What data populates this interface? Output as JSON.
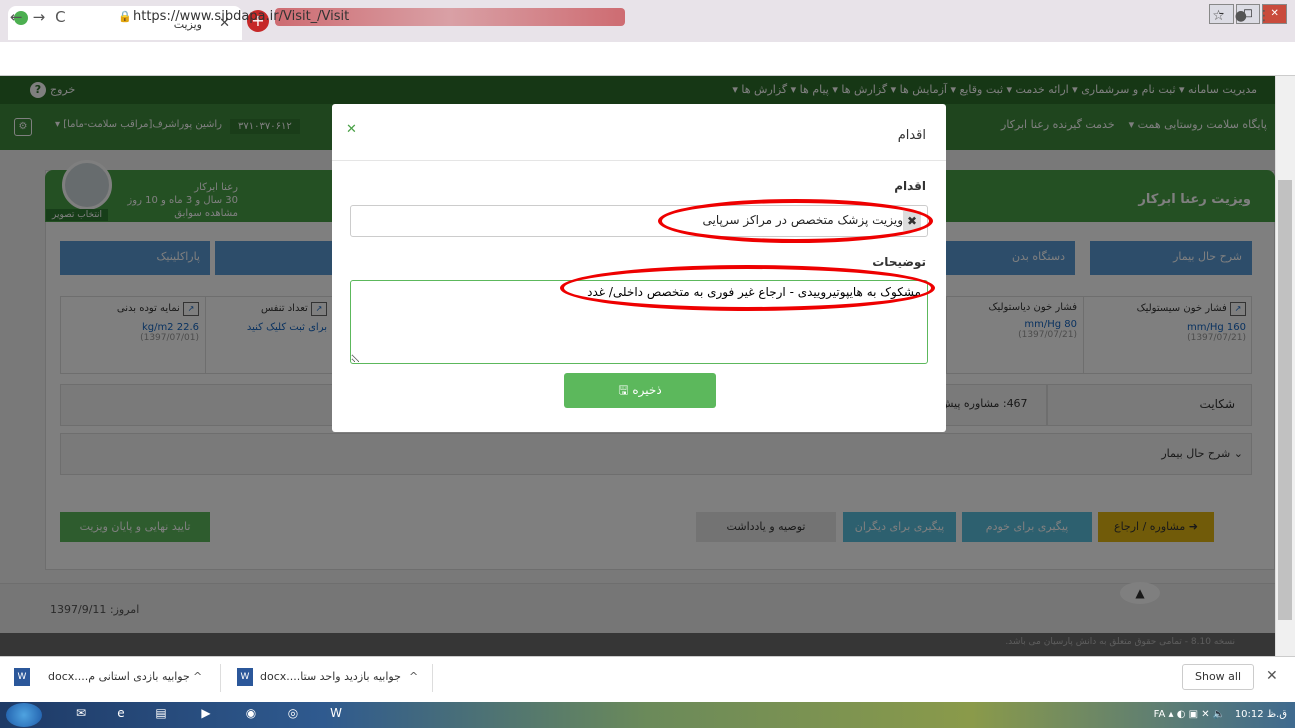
{
  "browser": {
    "tab_title": "ویزیت",
    "url": "https://www.sibdapa.ir/Visit_/Visit"
  },
  "topnav": {
    "menu": "مدیریت سامانه ▾   ثبت نام و سرشماری ▾   ارائه خدمت ▾   ثبت وقایع ▾   آزمایش ها ▾   گزارش ها ▾   پیام ها ▾   گزارش ها ▾",
    "exit": "خروج",
    "help": "?"
  },
  "subnav": {
    "facility": "پایگاه سلامت روستایی همت ▾",
    "recipient": "خدمت گیرنده رعنا ابرکار",
    "phone": "۳۷۱۰۳۷۰۶۱۲",
    "user": "راشین پوراشرف[مراقب سلامت-ماما] ▾"
  },
  "patient": {
    "visit_title": "ویزیت رعنا ابرکار",
    "name": "رعنا ابرکار",
    "age": "30 سال و 3 ماه و 10 روز",
    "history": "مشاهده سوابق",
    "photo_btn": "انتخاب تصویر"
  },
  "tabs": {
    "sharh": "شرح حال بیمار",
    "dastgah": "دستگاه بدن",
    "para": "پاراکلینیک"
  },
  "vitals": [
    {
      "label": "فشار خون سیستولیک",
      "value": "mm/Hg 160",
      "date": "(1397/07/21)"
    },
    {
      "label": "فشار خون دیاستولیک",
      "value": "mm/Hg 80",
      "date": "(1397/07/21)"
    },
    {
      "label": "تعداد تنفس",
      "value": "برای ثبت کلیک کنید",
      "date": ""
    },
    {
      "label": "نمایه توده بدنی",
      "value": "kg/m2 22.6",
      "date": "(1397/07/01)"
    }
  ],
  "complaint": {
    "label": "شکایت",
    "value": "467: مشاوره پیش"
  },
  "history_label": "شرح حال بیمار",
  "actions": {
    "referral": "مشاوره / ارجاع",
    "self": "پیگیری برای خودم",
    "others": "پیگیری برای دیگران",
    "note": "توصیه و یادداشت",
    "final": "تایید نهایی و پایان ویزیت"
  },
  "footer": {
    "today": "امروز: 1397/9/11",
    "version": "نسخه 8.10 - تمامی حقوق متعلق به دانش پارسیان می باشد."
  },
  "modal": {
    "title": "اقدام",
    "action_label": "اقدام",
    "action_value": "ویزیت پزشک متخصص در مراکز سرپایی",
    "desc_label": "توضیحات",
    "desc_value": "مشکوک به هایپوتیروییدی - ارجاع غیر فوری به متخصص داخلی/ غدد",
    "save": "ذخیره"
  },
  "downloads": {
    "item1": "جوابیه بازدی استانی م....docx",
    "item2": "جوابیه بازدید واحد ستا....docx",
    "show_all": "Show all"
  },
  "taskbar": {
    "lang": "FA",
    "time": "10:12 ق.ظ"
  }
}
